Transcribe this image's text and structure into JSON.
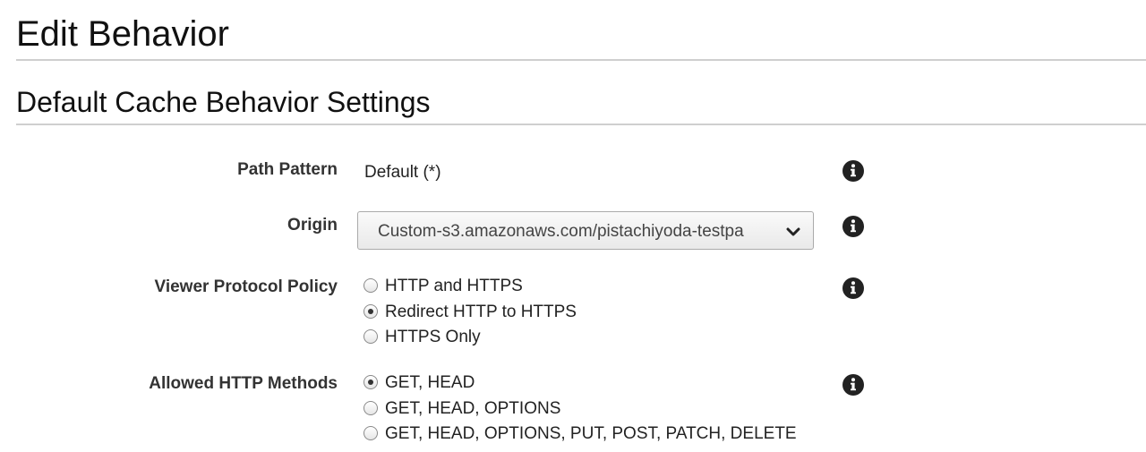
{
  "page": {
    "title": "Edit Behavior"
  },
  "section": {
    "title": "Default Cache Behavior Settings"
  },
  "path_pattern": {
    "label": "Path Pattern",
    "value": "Default (*)"
  },
  "origin": {
    "label": "Origin",
    "selected": "Custom-s3.amazonaws.com/pistachiyoda-testpa"
  },
  "viewer_protocol_policy": {
    "label": "Viewer Protocol Policy",
    "options": [
      {
        "label": "HTTP and HTTPS",
        "checked": false
      },
      {
        "label": "Redirect HTTP to HTTPS",
        "checked": true
      },
      {
        "label": "HTTPS Only",
        "checked": false
      }
    ]
  },
  "allowed_http_methods": {
    "label": "Allowed HTTP Methods",
    "options": [
      {
        "label": "GET, HEAD",
        "checked": true
      },
      {
        "label": "GET, HEAD, OPTIONS",
        "checked": false
      },
      {
        "label": "GET, HEAD, OPTIONS, PUT, POST, PATCH, DELETE",
        "checked": false
      }
    ]
  },
  "icons": {
    "info": "info-icon",
    "dropdown": "chevron-down-icon"
  }
}
